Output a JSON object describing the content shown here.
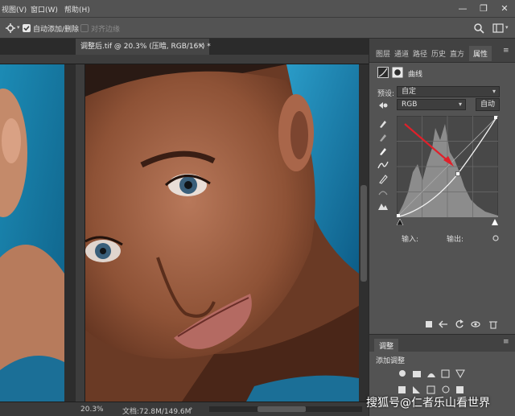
{
  "menubar": {
    "items": [
      "视图(V)",
      "窗口(W)",
      "帮助(H)"
    ],
    "minimize": "—",
    "restore": "❐",
    "close": "✕"
  },
  "options": {
    "auto_add_delete": "自动添加/删除",
    "align_edges": "对齐边缘"
  },
  "document": {
    "tab_title": "调整后.tif @ 20.3% (压暗, RGB/16*) *",
    "tab_close": "×",
    "zoom": "20.3%",
    "doc_info": "文档:72.8M/149.6M"
  },
  "panels": {
    "top_tabs": [
      "图层",
      "通道",
      "路径",
      "历史",
      "直方",
      "属性"
    ],
    "active_tab": "属性",
    "properties": {
      "title": "曲线",
      "preset_label": "预设:",
      "preset_value": "自定",
      "channel_value": "RGB",
      "auto_button": "自动",
      "input_label": "输入:",
      "output_label": "输出:"
    },
    "adjustments": {
      "tab": "调整",
      "add_label": "添加调整"
    }
  },
  "watermark": "搜狐号@仁者乐山看世界",
  "colors": {
    "accent_arrow": "#e0202a",
    "panel_bg": "#535353",
    "canvas_bg": "#282828"
  }
}
